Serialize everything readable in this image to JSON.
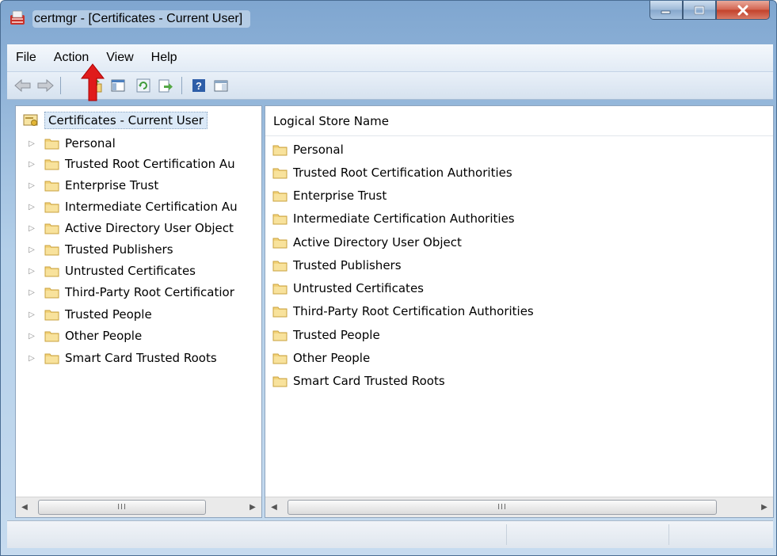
{
  "window": {
    "title": "certmgr - [Certificates - Current User]",
    "icon": "certmgr-app-icon"
  },
  "caption_buttons": [
    "minimize-icon",
    "maximize-icon",
    "close-icon"
  ],
  "menu": [
    "File",
    "Action",
    "View",
    "Help"
  ],
  "toolbar": {
    "buttons": [
      "back-arrow-icon",
      "forward-arrow-icon",
      "up-one-level-icon",
      "show-hide-console-tree-icon",
      "refresh-icon",
      "export-list-icon",
      "help-icon",
      "action-pane-icon"
    ]
  },
  "annotation": {
    "target": "Action",
    "color": "#e01b1b"
  },
  "tree": {
    "root": "Certificates - Current User",
    "items": [
      "Personal",
      "Trusted Root Certification Au",
      "Enterprise Trust",
      "Intermediate Certification Au",
      "Active Directory User Object",
      "Trusted Publishers",
      "Untrusted Certificates",
      "Third-Party Root Certificatior",
      "Trusted People",
      "Other People",
      "Smart Card Trusted Roots"
    ]
  },
  "list": {
    "column_header": "Logical Store Name",
    "items": [
      "Personal",
      "Trusted Root Certification Authorities",
      "Enterprise Trust",
      "Intermediate Certification Authorities",
      "Active Directory User Object",
      "Trusted Publishers",
      "Untrusted Certificates",
      "Third-Party Root Certification Authorities",
      "Trusted People",
      "Other People",
      "Smart Card Trusted Roots"
    ]
  },
  "scrollbars": {
    "left_thumb_label": "III",
    "right_thumb_label": "III"
  },
  "colors": {
    "folder": "#f3d37a",
    "frame": "#b3cfe9",
    "close_button": "#c2412a"
  }
}
